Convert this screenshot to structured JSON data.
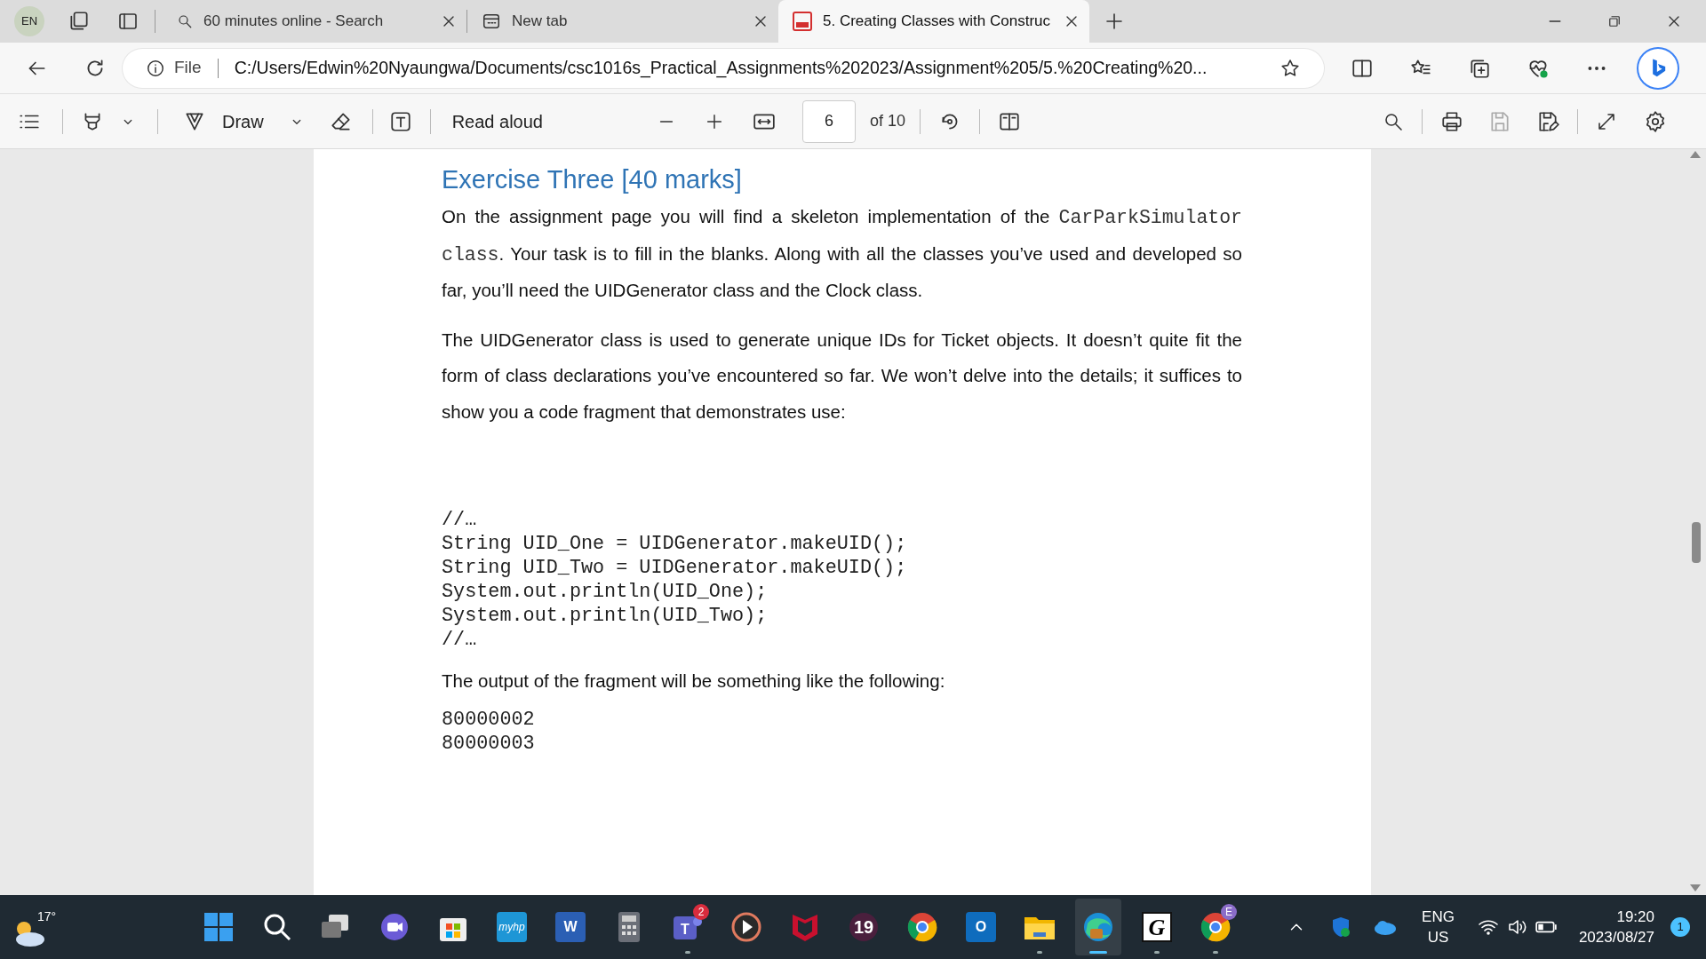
{
  "profile": "EN",
  "tabs": [
    {
      "kind": "search",
      "title": "60 minutes online - Search",
      "selected": false
    },
    {
      "kind": "newtab",
      "title": "New tab",
      "selected": false
    },
    {
      "kind": "pdf",
      "title": "5. Creating Classes with Construc",
      "selected": true
    }
  ],
  "address_bar": {
    "scheme": "File",
    "url": "C:/Users/Edwin%20Nyaungwa/Documents/csc1016s_Practical_Assignments%202023/Assignment%205/5.%20Creating%20..."
  },
  "pdf_toolbar": {
    "draw_label": "Draw",
    "read_aloud": "Read aloud",
    "page": "6",
    "page_count": "of 10"
  },
  "document": {
    "heading": "Exercise Three [40 marks]",
    "paragraphs": [
      [
        {
          "kind": "text",
          "text": "On the assignment page you will find a skeleton implementation of the "
        },
        {
          "kind": "code",
          "text": "CarParkSimulator class"
        },
        {
          "kind": "text",
          "text": ". Your task is to fill in the blanks.  Along with all the classes you’ve used and developed so far, you’ll need the UIDGenerator class and the Clock class."
        }
      ],
      [
        {
          "kind": "text",
          "text": "The UIDGenerator class is used to generate unique IDs for Ticket objects. It doesn’t quite fit the form of class declarations you’ve encountered so far. We won’t delve into the details; it suffices to show you a code fragment that demonstrates use:"
        }
      ]
    ],
    "code": [
      "//…",
      "String UID_One = UIDGenerator.makeUID();",
      "String UID_Two = UIDGenerator.makeUID();",
      "System.out.println(UID_One);",
      "System.out.println(UID_Two);",
      "//…"
    ],
    "output_caption": "The output of the fragment will be something like the following:",
    "output": [
      "80000002",
      "80000003"
    ]
  },
  "taskbar": {
    "weather": "17°",
    "apps": [
      {
        "kind": "start",
        "running": false
      },
      {
        "kind": "search",
        "running": false
      },
      {
        "kind": "taskview",
        "running": false
      },
      {
        "kind": "chat",
        "running": false
      },
      {
        "kind": "store",
        "running": false
      },
      {
        "kind": "hp",
        "label": "myhp",
        "running": false
      },
      {
        "kind": "word",
        "label": "W",
        "running": false
      },
      {
        "kind": "calculator",
        "running": false
      },
      {
        "kind": "teams",
        "label": "T",
        "badge": "2",
        "running": true
      },
      {
        "kind": "player",
        "running": false
      },
      {
        "kind": "mcafee",
        "running": false
      },
      {
        "kind": "nineteen",
        "label": "19",
        "running": false
      },
      {
        "kind": "chrome",
        "running": false
      },
      {
        "kind": "outlook",
        "label": "O",
        "running": false
      },
      {
        "kind": "explorer",
        "running": true
      },
      {
        "kind": "edge",
        "running": true,
        "selected": true
      },
      {
        "kind": "g",
        "label": "G",
        "running": true
      },
      {
        "kind": "chrome",
        "badge": "E",
        "running": true
      }
    ],
    "language": [
      "ENG",
      "US"
    ],
    "time": "19:20",
    "date": "2023/08/27",
    "notifications": "1"
  }
}
